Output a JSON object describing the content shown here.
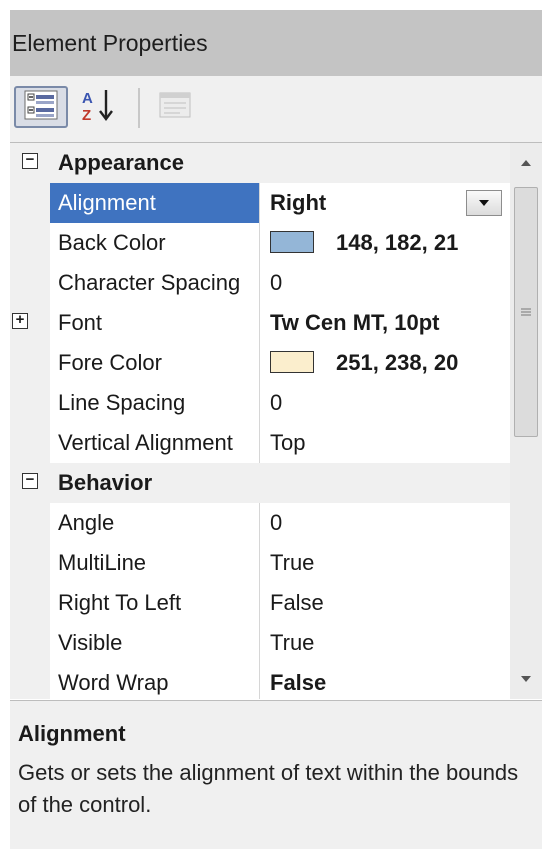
{
  "window": {
    "title": "Element Properties"
  },
  "toolbar": {
    "categorized_icon": "categorized-icon",
    "alphabetical_icon": "alphabetical-icon",
    "property_pages_icon": "property-pages-icon"
  },
  "colors": {
    "selection": "#3f73c0",
    "back_color_swatch": "#94b6d7",
    "fore_color_swatch": "#fbeecd"
  },
  "grid": {
    "appearance": {
      "label": "Appearance",
      "expander": "⊟",
      "props": [
        {
          "name": "Alignment",
          "value": "Right"
        },
        {
          "name": "Back Color",
          "value": "148, 182, 21"
        },
        {
          "name": "Character Spacing",
          "value": "0"
        },
        {
          "name": "Font",
          "value": "Tw Cen MT, 10pt",
          "expander": "⊞"
        },
        {
          "name": "Fore Color",
          "value": "251, 238, 20"
        },
        {
          "name": "Line Spacing",
          "value": "0"
        },
        {
          "name": "Vertical Alignment",
          "value": "Top"
        }
      ]
    },
    "behavior": {
      "label": "Behavior",
      "expander": "⊟",
      "props": [
        {
          "name": "Angle",
          "value": "0"
        },
        {
          "name": "MultiLine",
          "value": "True"
        },
        {
          "name": "Right To Left",
          "value": "False"
        },
        {
          "name": "Visible",
          "value": "True"
        },
        {
          "name": "Word Wrap",
          "value": "False"
        }
      ]
    }
  },
  "description": {
    "title": "Alignment",
    "text": "Gets or sets the alignment of text within the bounds of the control."
  }
}
